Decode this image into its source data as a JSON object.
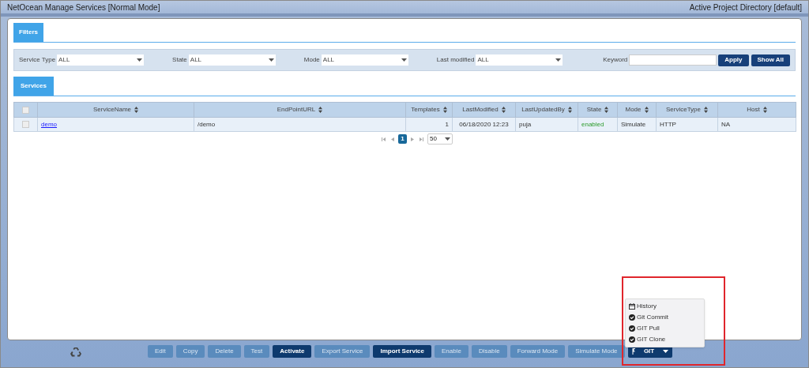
{
  "window": {
    "title": "NetOcean Manage Services [Normal Mode]",
    "project": "Active Project Directory [default]"
  },
  "filters": {
    "tab": "Filters",
    "fields": [
      {
        "label": "Service Type",
        "value": "ALL"
      },
      {
        "label": "State",
        "value": "ALL"
      },
      {
        "label": "Mode",
        "value": "ALL"
      },
      {
        "label": "Last modified",
        "value": "ALL"
      }
    ],
    "keyword": {
      "label": "Keyword"
    },
    "buttons": [
      "Apply",
      "Show All"
    ]
  },
  "services": {
    "tab": "Services",
    "table": {
      "select_all": {
        "checked": false
      },
      "columns": [
        "ServiceName",
        "EndPointURL",
        "Templates",
        "LastModified",
        "LastUpdatedBy",
        "State",
        "Mode",
        "ServiceType",
        "Host"
      ],
      "rows": [
        {
          "checked": false,
          "cells": [
            "demo",
            "/demo",
            "1",
            "06/18/2020 12:23",
            "puja",
            "enabled",
            "Simulate",
            "HTTP",
            "NA"
          ]
        }
      ]
    },
    "pagination": {
      "pages": [
        {
          "label": "1",
          "selected": true
        }
      ],
      "page_size": "50"
    }
  },
  "toolbar": {
    "buttons": [
      {
        "label": "Edit",
        "disabled": true
      },
      {
        "label": "Copy",
        "disabled": true
      },
      {
        "label": "Delete",
        "disabled": true
      },
      {
        "label": "Test",
        "disabled": true
      },
      {
        "label": "Activate",
        "disabled": false
      },
      {
        "label": "Export Service",
        "disabled": true
      },
      {
        "label": "Import Service",
        "disabled": false
      },
      {
        "label": "Enable",
        "disabled": true
      },
      {
        "label": "Disable",
        "disabled": true
      },
      {
        "label": "Forward Mode",
        "disabled": true
      },
      {
        "label": "Simulate Mode",
        "disabled": true
      }
    ],
    "git": {
      "label": "GIT",
      "expanded": true,
      "menu": [
        {
          "label": "History",
          "kind": "calendar"
        },
        {
          "label": "Git Commit",
          "kind": "check"
        },
        {
          "label": "GIT Pull",
          "kind": "check"
        },
        {
          "label": "GIT Clone",
          "kind": "check"
        }
      ]
    }
  }
}
